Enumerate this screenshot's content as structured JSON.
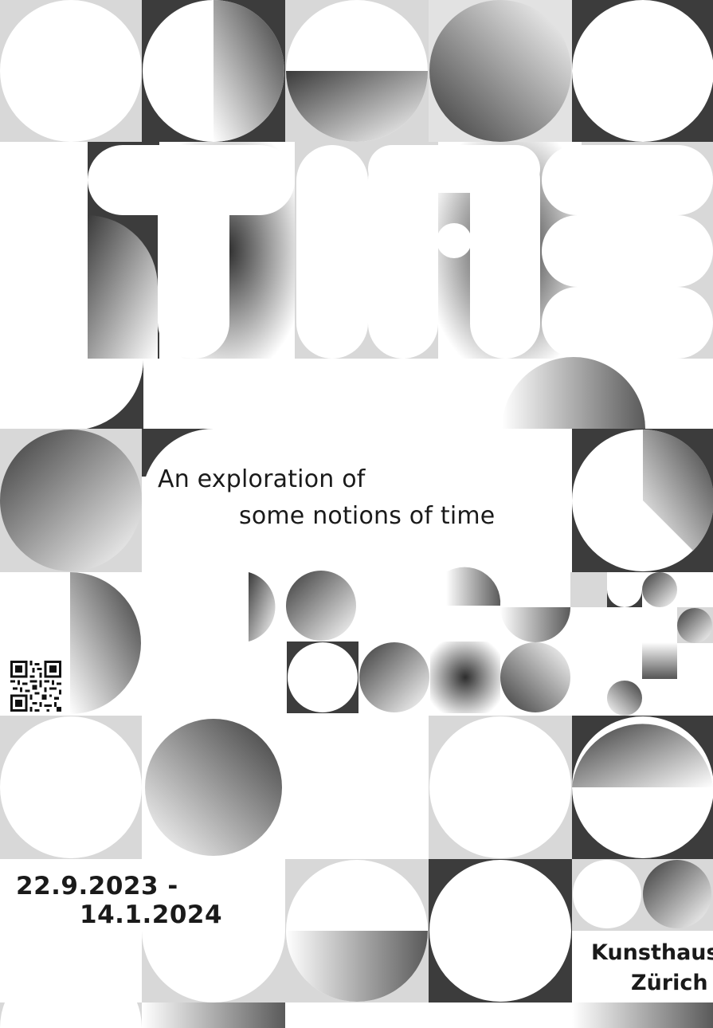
{
  "poster": {
    "headline": "TIME",
    "tagline": [
      "An exploration of",
      "some notions of time"
    ],
    "dates": [
      "22.9.2023 -",
      "14.1.2024"
    ],
    "venue": [
      "Kunsthaus",
      "Zürich"
    ]
  },
  "colors": {
    "background": "#ffffff",
    "light_gray": "#d6d6d6",
    "mid_gray": "#a8a8a8",
    "dark_gray": "#3c3c3c",
    "text": "#1a1a1a"
  },
  "icons": [
    "qr-code-icon"
  ]
}
